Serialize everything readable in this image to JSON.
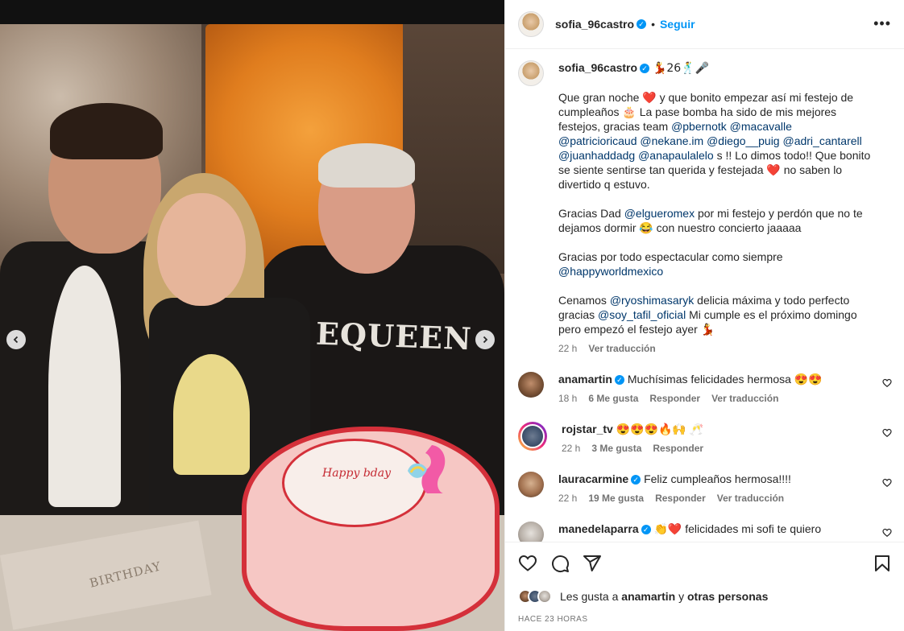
{
  "photo": {
    "sweater_text": "EQUEEN",
    "cake_writing": "Happy bday",
    "card_text": "BIRTHDAY"
  },
  "header": {
    "username": "sofia_96castro",
    "verified": true,
    "separator": "•",
    "follow_label": "Seguir",
    "more_label": "•••"
  },
  "caption": {
    "username": "sofia_96castro",
    "emojis": "💃26🕺🎤",
    "paragraphs": [
      [
        {
          "t": "Que gran noche ❤️ y que bonito empezar así mi festejo de cumpleaños 🎂 La pase bomba ha sido de mis mejores festejos, gracias team "
        },
        {
          "m": "@pbernotk"
        },
        {
          "t": " "
        },
        {
          "m": "@macavalle"
        },
        {
          "t": " "
        },
        {
          "m": "@patricioricaud"
        },
        {
          "t": " "
        },
        {
          "m": "@nekane.im"
        },
        {
          "t": " "
        },
        {
          "m": "@diego__puig"
        },
        {
          "t": " "
        },
        {
          "m": "@adri_cantarell"
        },
        {
          "t": " "
        },
        {
          "m": "@juanhaddadg"
        },
        {
          "t": " "
        },
        {
          "m": "@anapaulalelo"
        },
        {
          "t": " s !! Lo dimos todo!! Que bonito se siente sentirse tan querida y festejada ❤️ no saben lo divertido q estuvo."
        }
      ],
      [
        {
          "t": "Gracias Dad "
        },
        {
          "m": "@elgueromex"
        },
        {
          "t": " por mi festejo y perdón que no te dejamos dormir 😂 con nuestro concierto jaaaaa"
        }
      ],
      [
        {
          "t": "Gracias por todo espectacular como siempre "
        },
        {
          "m": "@happyworldmexico"
        }
      ],
      [
        {
          "t": "Cenamos "
        },
        {
          "m": "@ryoshimasaryk"
        },
        {
          "t": " delicia máxima y todo perfecto gracias "
        },
        {
          "m": "@soy_tafil_oficial"
        },
        {
          "t": " Mi cumple es el próximo domingo pero empezó el festejo ayer 💃"
        }
      ]
    ],
    "time": "22 h",
    "translate": "Ver traducción"
  },
  "comments": [
    {
      "username": "anamartin",
      "verified": true,
      "text": "Muchísimas felicidades hermosa 😍😍",
      "time": "18 h",
      "likes": "6 Me gusta",
      "reply": "Responder",
      "translate": "Ver traducción",
      "avatar": "av-ana",
      "ring": false
    },
    {
      "username": "rojstar_tv",
      "verified": false,
      "text": "😍😍😍🔥🙌 🥂",
      "time": "22 h",
      "likes": "3 Me gusta",
      "reply": "Responder",
      "translate": "",
      "avatar": "av-roj",
      "ring": true
    },
    {
      "username": "lauracarmine",
      "verified": true,
      "text": "Feliz cumpleaños hermosa!!!!",
      "time": "22 h",
      "likes": "19 Me gusta",
      "reply": "Responder",
      "translate": "Ver traducción",
      "avatar": "av-laura",
      "ring": false
    },
    {
      "username": "manedelaparra",
      "verified": true,
      "text": "👏❤️ felicidades mi sofi te quiero",
      "time": "",
      "likes": "",
      "reply": "",
      "translate": "",
      "avatar": "av-mane",
      "ring": false
    }
  ],
  "actions": {
    "likes_prefix": "Les gusta a",
    "likes_user": "anamartin",
    "likes_and": "y",
    "likes_others": "otras personas",
    "timestamp": "HACE 23 HORAS"
  },
  "colors": {
    "accent": "#0095f6",
    "mention": "#00376b",
    "muted": "#737373",
    "text": "#262626",
    "border": "#efefef"
  },
  "icons": [
    "verified-icon",
    "more-icon",
    "heart-icon",
    "comment-icon",
    "share-icon",
    "save-icon",
    "chevron-left-icon",
    "chevron-right-icon"
  ]
}
